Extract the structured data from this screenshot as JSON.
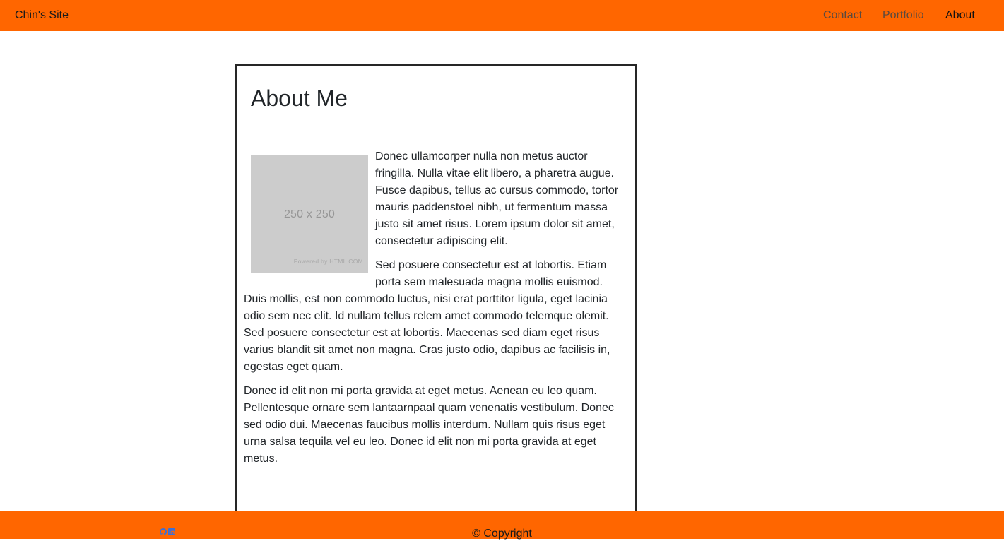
{
  "nav": {
    "brand": "Chin's Site",
    "links": [
      {
        "label": "Contact"
      },
      {
        "label": "Portfolio"
      },
      {
        "label": "About"
      }
    ],
    "active_link": "About"
  },
  "about": {
    "heading": "About Me",
    "image": {
      "dims_label": "250 x 250",
      "powered_label": "Powered by HTML.COM"
    },
    "paragraphs": [
      "Donec ullamcorper nulla non metus auctor fringilla. Nulla vitae elit libero, a pharetra augue. Fusce dapibus, tellus ac cursus commodo, tortor mauris paddenstoel nibh, ut fermentum massa justo sit amet risus. Lorem ipsum dolor sit amet, consectetur adipiscing elit.",
      "Sed posuere consectetur est at lobortis. Etiam porta sem malesuada magna mollis euismod. Duis mollis, est non commodo luctus, nisi erat porttitor ligula, eget lacinia odio sem nec elit. Id nullam tellus relem amet commodo telemque olemit. Sed posuere consectetur est at lobortis. Maecenas sed diam eget risus varius blandit sit amet non magna. Cras justo odio, dapibus ac facilisis in, egestas eget quam.",
      "Donec id elit non mi porta gravida at eget metus. Aenean eu leo quam. Pellentesque ornare sem lantaarnpaal quam venenatis vestibulum. Donec sed odio dui. Maecenas faucibus mollis interdum. Nullam quis risus eget urna salsa tequila vel eu leo. Donec id elit non mi porta gravida at eget metus."
    ]
  },
  "footer": {
    "social_icons": [
      "github-icon",
      "linkedin-icon"
    ],
    "copyright": "© Copyright"
  },
  "colors": {
    "brand_orange": "#ff6600",
    "icon_blue": "#3b6fd8"
  }
}
